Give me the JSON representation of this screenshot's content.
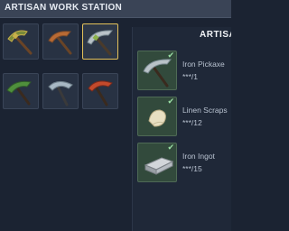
{
  "window": {
    "title": "ARTISAN WORK STATION"
  },
  "tools": [
    {
      "name": "green-gold-pickaxe",
      "head": "#7a8a3a",
      "accent": "#c9b04a"
    },
    {
      "name": "bronze-pickaxe",
      "head": "#b86a34",
      "accent": "#7a4a2a"
    },
    {
      "name": "iron-pickaxe",
      "head": "#b9c2c8",
      "accent": "#7a8a92",
      "selected": true
    },
    {
      "name": "jade-pickaxe",
      "head": "#4f8f3c",
      "accent": "#2f5a2a"
    },
    {
      "name": "steel-pickaxe",
      "head": "#a8b8c4",
      "accent": "#6f7f8a"
    },
    {
      "name": "crimson-pickaxe",
      "head": "#c24a2c",
      "accent": "#7a2a1c"
    }
  ],
  "panel": {
    "heading": "ARTISA",
    "requirements": [
      {
        "name": "Iron Pickaxe",
        "count": "***/1",
        "icon": "pickaxe-icon"
      },
      {
        "name": "Linen Scraps",
        "count": "***/12",
        "icon": "cloth-icon"
      },
      {
        "name": "Iron Ingot",
        "count": "***/15",
        "icon": "ingot-icon"
      }
    ]
  }
}
